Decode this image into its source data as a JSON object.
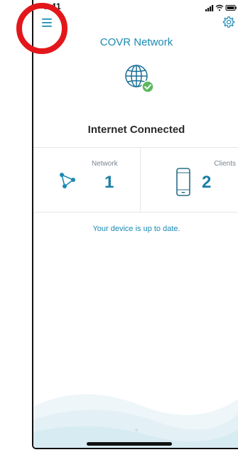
{
  "status_bar": {
    "time": "9:41",
    "icons": [
      "location-arrow-icon",
      "cellular-signal-icon",
      "wifi-icon",
      "battery-icon"
    ]
  },
  "header": {
    "menu_icon": "hamburger-menu-icon",
    "settings_icon": "gear-icon",
    "title": "COVR Network"
  },
  "internet": {
    "icon": "globe-icon",
    "badge_icon": "check-badge-icon",
    "status": "Internet Connected"
  },
  "stats": {
    "network": {
      "label": "Network",
      "value": "1",
      "icon": "network-nodes-icon"
    },
    "clients": {
      "label": "Clients",
      "value": "2",
      "icon": "phone-device-icon"
    }
  },
  "update_message": "Your device is up to date.",
  "annotation": {
    "highlight": "red-circle-around-menu"
  },
  "colors": {
    "accent": "#1b8ab3",
    "value_blue": "#1b7fa6",
    "success_green": "#5cb85c",
    "highlight_red": "#e3171b",
    "wave_light": "#e8f3f7"
  }
}
